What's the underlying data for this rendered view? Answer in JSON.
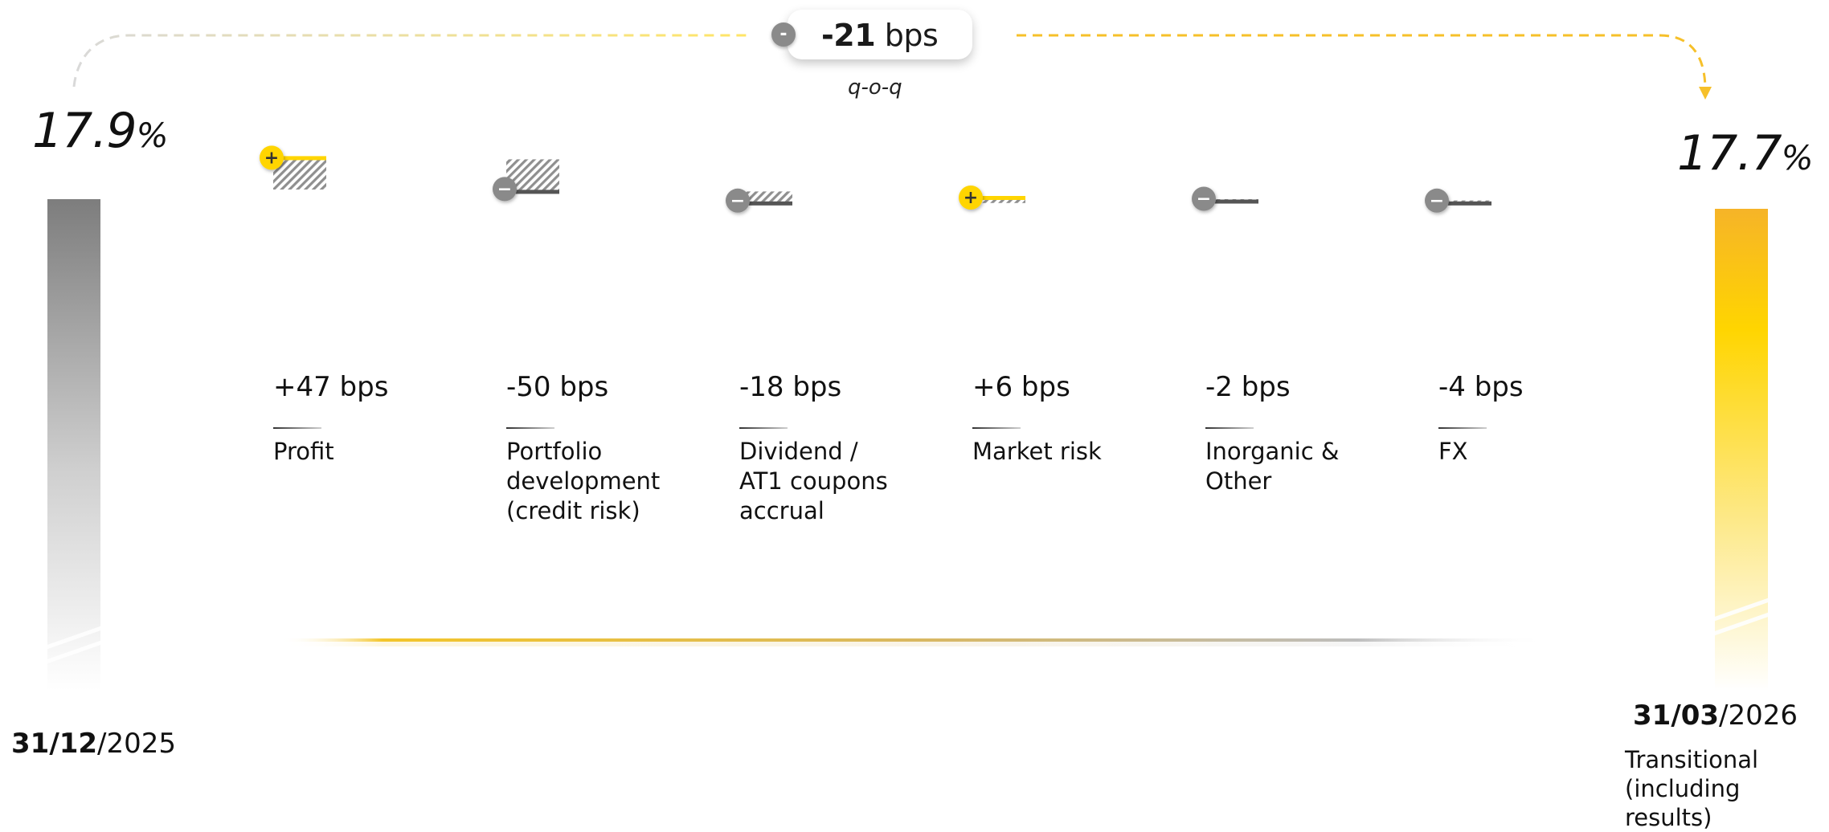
{
  "change": {
    "sign": "-",
    "value": "-21",
    "unit": "bps",
    "period": "q-o-q"
  },
  "start": {
    "value": "17.9",
    "unit": "%",
    "date_bold": "31/12",
    "date_rest": "/2025"
  },
  "end": {
    "value": "17.7",
    "unit": "%",
    "date_bold": "31/03",
    "date_rest": "/2026",
    "note_line1": "Transitional",
    "note_line2": "(including results)"
  },
  "colors": {
    "start_bar": "#7d7d7d",
    "end_bar": "#f6b428",
    "accent": "#ffd500",
    "negative_badge": "#8a8a8a",
    "positive_badge": "#ffd500"
  },
  "chart_data": {
    "type": "bar",
    "subtype": "waterfall",
    "unit": "bps",
    "start": 17.9,
    "end": 17.7,
    "categories": [
      "Profit",
      "Portfolio development (credit risk)",
      "Dividend / AT1 coupons accrual",
      "Market risk",
      "Inorganic & Other",
      "FX"
    ],
    "values": [
      47,
      -50,
      -18,
      6,
      -2,
      -4
    ],
    "steps": [
      {
        "value_label": "+47 bps",
        "label_lines": [
          "Profit"
        ]
      },
      {
        "value_label": "-50 bps",
        "label_lines": [
          "Portfolio",
          "development",
          "(credit risk)"
        ]
      },
      {
        "value_label": "-18 bps",
        "label_lines": [
          "Dividend /",
          "AT1 coupons",
          "accrual"
        ]
      },
      {
        "value_label": "+6 bps",
        "label_lines": [
          "Market risk"
        ]
      },
      {
        "value_label": "-2 bps",
        "label_lines": [
          "Inorganic &",
          "Other"
        ]
      },
      {
        "value_label": "-4 bps",
        "label_lines": [
          "FX"
        ]
      }
    ]
  }
}
